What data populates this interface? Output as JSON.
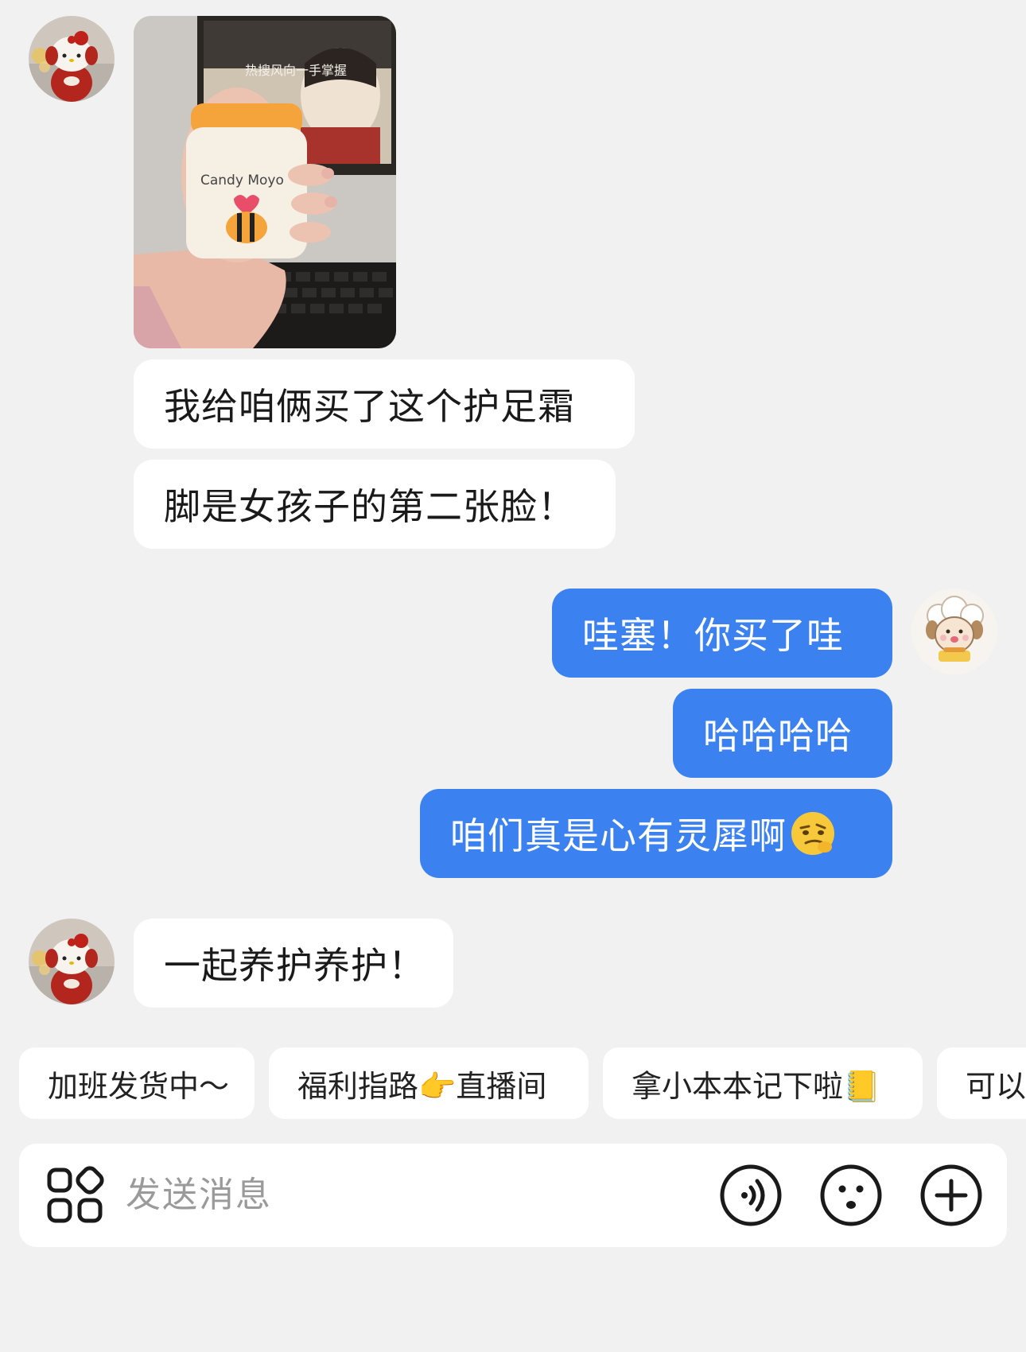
{
  "conversation": {
    "photo_label": "Candy Moyo",
    "photo_screen_text": "热搜风向一手掌握",
    "messages_left_1": [
      "我给咱俩买了这个护足霜",
      "脚是女孩子的第二张脸！"
    ],
    "messages_right": [
      "哇塞！你买了哇",
      "哈哈哈哈",
      "咱们真是心有灵犀啊"
    ],
    "messages_left_2": [
      "一起养护养护！"
    ]
  },
  "quick_replies": [
    "加班发货中～",
    "福利指路👉直播间",
    "拿小本本记下啦📒",
    "可以"
  ],
  "input_bar": {
    "placeholder": "发送消息",
    "icons": [
      "apps-grid-icon",
      "voice-icon",
      "emoji-icon",
      "plus-icon"
    ]
  },
  "colors": {
    "background": "#f1f1f1",
    "bubble_left": "#ffffff",
    "bubble_right": "#3b82f0",
    "placeholder": "#9a9a9a"
  }
}
